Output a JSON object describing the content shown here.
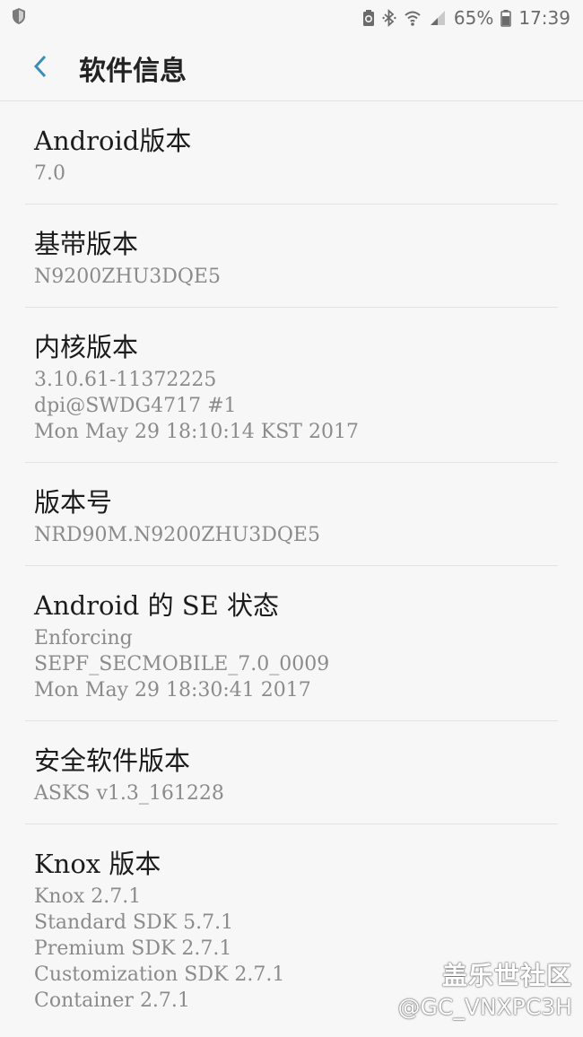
{
  "status_bar": {
    "left_icon": "shield-icon",
    "battery_percent": "65%",
    "time": "17:39",
    "icons": [
      "battery-saver-icon",
      "bluetooth-icon",
      "wifi-icon",
      "signal-icon",
      "battery-icon"
    ]
  },
  "header": {
    "back_icon": "chevron-left-icon",
    "title": "软件信息"
  },
  "items": [
    {
      "title": "Android版本",
      "values": [
        "7.0"
      ]
    },
    {
      "title": "基带版本",
      "values": [
        "N9200ZHU3DQE5"
      ]
    },
    {
      "title": "内核版本",
      "values": [
        "3.10.61-11372225",
        "dpi@SWDG4717 #1",
        "Mon May 29 18:10:14 KST 2017"
      ]
    },
    {
      "title": "版本号",
      "values": [
        "NRD90M.N9200ZHU3DQE5"
      ]
    },
    {
      "title": "Android 的 SE 状态",
      "values": [
        "Enforcing",
        "SEPF_SECMOBILE_7.0_0009",
        "Mon May 29 18:30:41 2017"
      ]
    },
    {
      "title": "安全软件版本",
      "values": [
        "ASKS v1.3_161228"
      ]
    },
    {
      "title": "Knox 版本",
      "values": [
        "Knox 2.7.1",
        "Standard SDK 5.7.1",
        "Premium SDK 2.7.1",
        "Customization SDK 2.7.1",
        "Container 2.7.1"
      ]
    }
  ],
  "watermark": {
    "site": "盖乐世社区",
    "user": "@GC_VNXPC3H"
  },
  "colors": {
    "accent": "#3a8fb7",
    "background": "#f7f7f7",
    "secondary_text": "#8b8b8b"
  }
}
